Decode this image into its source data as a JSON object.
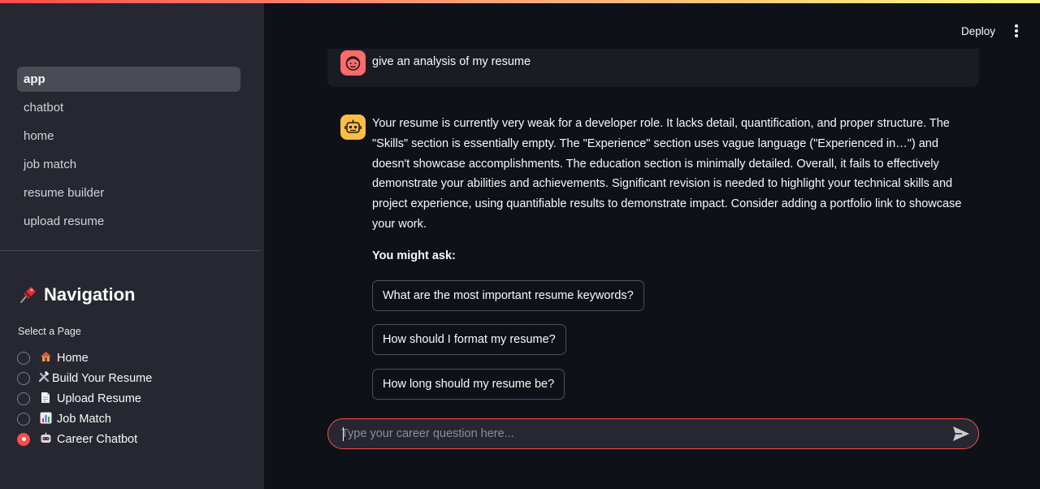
{
  "sidebar": {
    "pages": [
      {
        "label": "app",
        "active": true
      },
      {
        "label": "chatbot",
        "active": false
      },
      {
        "label": "home",
        "active": false
      },
      {
        "label": "job match",
        "active": false
      },
      {
        "label": "resume builder",
        "active": false
      },
      {
        "label": "upload resume",
        "active": false
      }
    ],
    "nav_heading": "Navigation",
    "nav_heading_icon": "pushpin-icon",
    "select_label": "Select a Page",
    "radio_options": [
      {
        "icon": "house-icon",
        "label": "Home",
        "checked": false
      },
      {
        "icon": "hammer-wrench-icon",
        "label": "Build Your Resume",
        "checked": false
      },
      {
        "icon": "document-icon",
        "label": "Upload Resume",
        "checked": false
      },
      {
        "icon": "bar-chart-icon",
        "label": "Job Match",
        "checked": false
      },
      {
        "icon": "robot-icon",
        "label": "Career Chatbot",
        "checked": true
      }
    ]
  },
  "header": {
    "deploy_label": "Deploy",
    "menu_icon": "kebab-menu-icon"
  },
  "chat": {
    "user_message": "give an analysis of my resume",
    "user_avatar": "user-face-icon",
    "bot_avatar": "robot-face-icon",
    "bot_message": "Your resume is currently very weak for a developer role. It lacks detail, quantification, and proper structure. The \"Skills\" section is essentially empty. The \"Experience\" section uses vague language (\"Experienced in…\") and doesn't showcase accomplishments. The education section is minimally detailed. Overall, it fails to effectively demonstrate your abilities and achievements. Significant revision is needed to highlight your technical skills and project experience, using quantifiable results to demonstrate impact. Consider adding a portfolio link to showcase your work.",
    "suggestions_heading": "You might ask:",
    "suggestions": [
      "What are the most important resume keywords?",
      "How should I format my resume?",
      "How long should my resume be?"
    ]
  },
  "input": {
    "placeholder": "Type your career question here...",
    "value": ""
  },
  "colors": {
    "accent": "#ff4b4b",
    "sidebar_bg": "#262730",
    "main_bg": "#0e1117",
    "bot_avatar": "#ffbd45",
    "user_avatar": "#ff6b6b"
  }
}
